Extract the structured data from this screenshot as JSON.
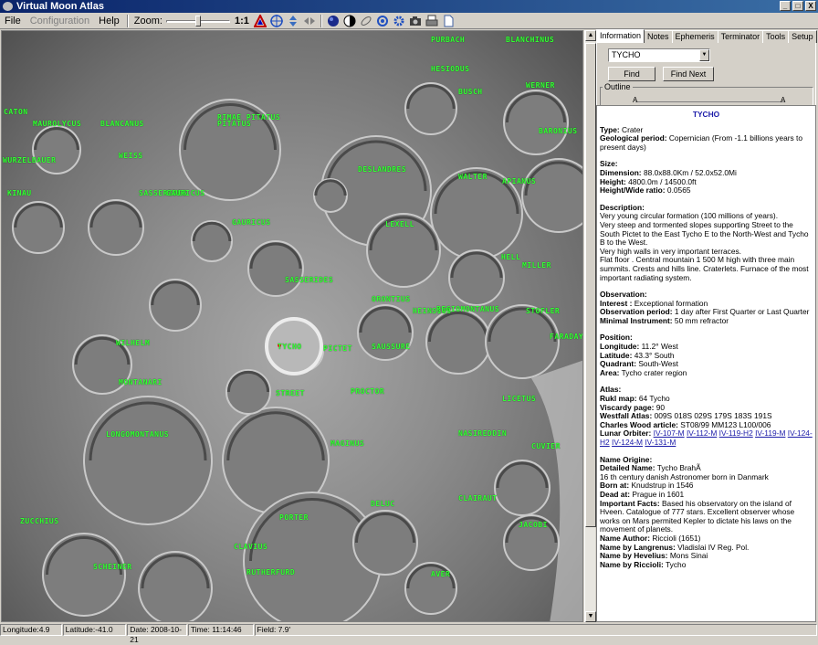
{
  "window": {
    "title": "Virtual Moon Atlas",
    "controls": [
      "_",
      "□",
      "X"
    ]
  },
  "menu": {
    "file": "File",
    "configuration": "Configuration",
    "help": "Help"
  },
  "toolbar": {
    "zoom_label": "Zoom:",
    "zoom_ratio": "1:1",
    "icons": [
      "grid-color-icon",
      "target-icon",
      "arrow-up-down-icon",
      "arrow-left-right-icon",
      "moon-dark-icon",
      "moon-phase-icon",
      "ellipse-icon",
      "rotate-icon",
      "settings-icon",
      "camera-icon",
      "print-icon",
      "document-icon"
    ]
  },
  "map": {
    "labels": [
      {
        "t": "CATON"
      },
      {
        "t": "RIMAE PITATUS"
      },
      {
        "t": "PITATUS"
      },
      {
        "t": "HESIODUS"
      },
      {
        "t": "WEISS"
      },
      {
        "t": "WURZELBAUER"
      },
      {
        "t": "GAURICUS"
      },
      {
        "t": "DESLANDRES"
      },
      {
        "t": "WALTER"
      },
      {
        "t": "LEXELL"
      },
      {
        "t": "HELL"
      },
      {
        "t": "SASSERIDES"
      },
      {
        "t": "ORONTIUS"
      },
      {
        "t": "HEINSIUS"
      },
      {
        "t": "WILHELM"
      },
      {
        "t": "TYCHO"
      },
      {
        "t": "PICTET"
      },
      {
        "t": "SAUSSURE"
      },
      {
        "t": "STREET"
      },
      {
        "t": "PROCTOR"
      },
      {
        "t": "LONGOMONTANUS"
      },
      {
        "t": "MONTANARI"
      },
      {
        "t": "MAGINUS"
      },
      {
        "t": "CLAVIUS"
      },
      {
        "t": "PORTER"
      },
      {
        "t": "DELUC"
      },
      {
        "t": "RUTHERFURD"
      },
      {
        "t": "SCHEINER"
      },
      {
        "t": "STOFLER"
      },
      {
        "t": "LICETUS"
      },
      {
        "t": "CUVIER"
      },
      {
        "t": "JACOBI"
      },
      {
        "t": "CLAIRAUT"
      },
      {
        "t": "MAUROLYCUS"
      },
      {
        "t": "BARONIUS"
      },
      {
        "t": "NASIREDDIN"
      },
      {
        "t": "MILLER"
      },
      {
        "t": "REGIOMONTANUS"
      },
      {
        "t": "WERNER"
      },
      {
        "t": "APIANUS"
      },
      {
        "t": "BLANCHINUS"
      },
      {
        "t": "PURBACH"
      },
      {
        "t": "ZUCCHIUS"
      },
      {
        "t": "BLANCANUS"
      },
      {
        "t": "KINAU"
      },
      {
        "t": "SASSERIDES"
      },
      {
        "t": "GAURICUS"
      },
      {
        "t": "BUSCH"
      },
      {
        "t": "AVER"
      },
      {
        "t": "FARADAY"
      }
    ]
  },
  "panel": {
    "tabs": [
      "Information",
      "Notes",
      "Ephemeris",
      "Terminator",
      "Tools",
      "Setup"
    ],
    "search_value": "TYCHO",
    "find_button": "Find",
    "find_next_button": "Find Next",
    "outline_label": "Outline",
    "outline_left": "A",
    "outline_right": "A"
  },
  "info": {
    "title": "TYCHO",
    "type_label": "Type:",
    "type_value": "Crater",
    "geo_label": "Geological period:",
    "geo_value": "Copernician (From -1.1 billions years to present days)",
    "size_hd": "Size:",
    "dim_label": "Dimension:",
    "dim_value": "88.0x88.0Km / 52.0x52.0Mi",
    "height_label": "Height:",
    "height_value": "4800.0m / 14500.0ft",
    "ratio_label": "Height/Wide ratio:",
    "ratio_value": "0.0565",
    "desc_hd": "Description:",
    "desc_1": "Very young circular formation (100 millions of years).",
    "desc_2": "Very steep and tormented slopes supporting Street to the South Pictet to the East Tycho E to the North-West and Tycho B to the West.",
    "desc_3": "Very high walls in very important terraces.",
    "desc_4": "Flat floor . Central mountain 1 500 M high with three main summits. Crests and hills line. Craterlets. Furnace of the most important radiating system.",
    "obs_hd": "Observation:",
    "interest_label": "Interest :",
    "interest_value": "Exceptional formation",
    "period_label": "Observation period:",
    "period_value": "1 day after First Quarter or Last Quarter",
    "instr_label": "Minimal Instrument:",
    "instr_value": "50 mm refractor",
    "pos_hd": "Position:",
    "lon_label": "Longitude:",
    "lon_value": "11.2° West",
    "lat_label": "Latitude:",
    "lat_value": "43.3° South",
    "quad_label": "Quadrant:",
    "quad_value": "South-West",
    "area_label": "Area:",
    "area_value": "Tycho crater region",
    "atlas_hd": "Atlas:",
    "rukl_label": "Rukl map:",
    "rukl_value": "64 Tycho",
    "visc_label": "Viscardy page:",
    "visc_value": "90",
    "west_label": "Westfall Atlas:",
    "west_value": "009S 018S 029S 179S 183S 191S",
    "wood_label": "Charles Wood article:",
    "wood_value": "ST08/99 MM123 L100/006",
    "lo_label": "Lunar Orbiter:",
    "lo_links": [
      "IV-107-M",
      "IV-112-M",
      "IV-119-H2",
      "IV-119-M",
      "IV-124-H2",
      "IV-124-M",
      "IV-131-M"
    ],
    "name_hd": "Name Origine:",
    "detailed_label": "Detailed Name:",
    "detailed_value": "Tycho BrahÃ",
    "century": "16 th century danish Astronomer born in Danmark",
    "born_label": "Born at:",
    "born_value": "Knudstrup in 1546",
    "dead_label": "Dead at:",
    "dead_value": "Prague in 1601",
    "facts_label": "Important Facts:",
    "facts_value": "Based his observatory on the island of Hveen. Catalogue of 777 stars. Excellent observer whose works on Mars permited Kepler to dictate his laws on the movement of planets.",
    "author_label": "Name Author:",
    "author_value": "Riccioli (1651)",
    "langrenus_label": "Name by Langrenus:",
    "langrenus_value": "Vladislai IV Reg. Pol.",
    "hevelius_label": "Name by Hevelius:",
    "hevelius_value": "Mons Sinai",
    "riccioli_label": "Name by Riccioli:",
    "riccioli_value": "Tycho"
  },
  "status": {
    "longitude": "Longitude:4.9",
    "latitude": "Latitude:-41.0",
    "date": "Date: 2008-10-21",
    "time": "Time: 11:14:46",
    "field": "Field: 7.9'"
  }
}
